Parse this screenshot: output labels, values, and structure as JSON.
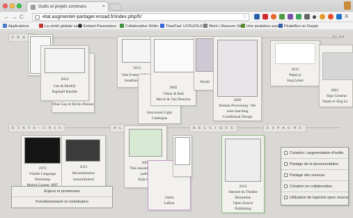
{
  "browser": {
    "tab_title": "Outils et projets communs",
    "tab_close": "×",
    "url": "etat.augmenter-partager.ensad.fr/index.php/fr/",
    "back": "←",
    "forward": "→",
    "reload": "C",
    "home": "⌂",
    "star": "☆",
    "menu": "≡",
    "bookmarks": [
      {
        "label": "Applications",
        "color": "#4a78c4"
      },
      {
        "label": "La vérité globale sur",
        "color": "#c0392b"
      },
      {
        "label": "Embed Parameters",
        "color": "#333333"
      },
      {
        "label": "Collaborative Writin",
        "color": "#3d8f3d"
      },
      {
        "label": "TitanPad: UCl%2OLD",
        "color": "#3367d6"
      },
      {
        "label": "Work | Museum Stu",
        "color": "#7a7a7a"
      },
      {
        "label": "Une piratebox avec",
        "color": "#5a8f2f"
      },
      {
        "label": "PirateBox on Raspb",
        "color": "#2e5fa8"
      }
    ]
  },
  "sections": {
    "france": "F R A N",
    "etats_unis": "É T A T S - U N I S",
    "allemagne": "A L L E",
    "belgique": "B E L G I Q U E",
    "espagne": "E S P A G N E",
    "right_partial": "fr  en"
  },
  "cards": {
    "use_modify": {
      "year": "2014",
      "title": "Use & Modify",
      "author": "Raphaël Bastide"
    },
    "elise": {
      "author": "Elise Gay et Kevin Donnot"
    },
    "one_frame": {
      "year": "2013",
      "title": "One Frame of Fame",
      "author": "Jonathan Puckey"
    },
    "vikiar": {
      "year": "2002",
      "title": "Vikiar & Ball",
      "author": "Mevis & Van Deursen"
    },
    "structured": {
      "line1": "Structured Light",
      "line2": "Catalogue"
    },
    "world": {
      "title": "World"
    },
    "human": {
      "year": "2009",
      "title": "Human Processing / We",
      "title2": "were hatching",
      "author": "Conditional Design"
    },
    "paperjs": {
      "year": "2012",
      "title": "Paper.js",
      "author": "Jorg Lehni"
    },
    "sign": {
      "year": "2003",
      "title": "Sign Generat",
      "author": "Naam et Jürg Le"
    },
    "visible": {
      "year": "1973",
      "title": "Visible Language",
      "title2": "Workshop",
      "author": "Muriel Cooper, MIT"
    },
    "recons": {
      "year": "2012",
      "title": "Reconstitution",
      "author": "Sonoinfinited"
    },
    "made_public": {
      "year": "2007",
      "title": "This should be made",
      "title2": "public",
      "author": "Anja Lutz"
    },
    "chenu": {
      "line1": "chenu",
      "line2": "LaBon"
    },
    "identite": {
      "year": "2013",
      "title": "Identité du Théâtre",
      "title2": "Balsamine",
      "author": "Open Source",
      "author2": "Publishing"
    }
  },
  "legend": {
    "row1": "Enjeux et promesses",
    "row2": "Fonctionnement et contribution"
  },
  "filters": [
    "Création / augmentation d'outils",
    "Partage de la documentation",
    "Partage des sources",
    "Création en collaboration",
    "Utilisation de logiciels open source"
  ]
}
